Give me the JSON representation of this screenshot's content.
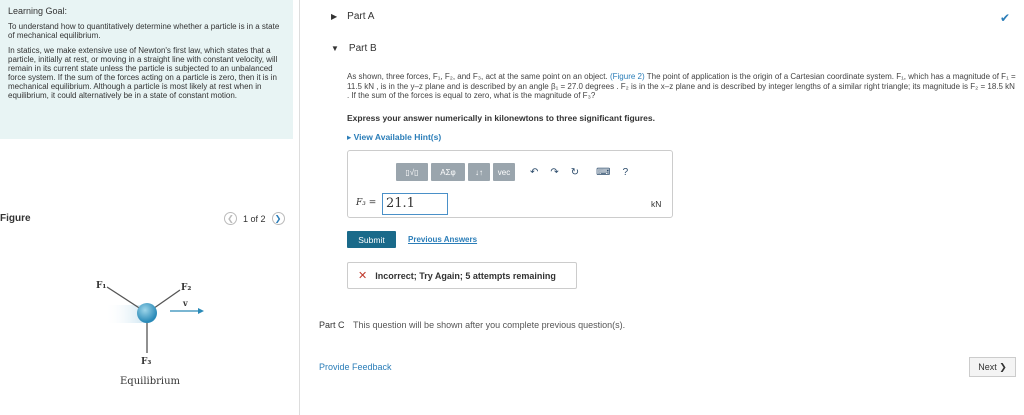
{
  "learning_goal": {
    "title": "Learning Goal:",
    "intro": "To understand how to quantitatively determine whether a particle is in a state of mechanical equilibrium.",
    "body": "In statics, we make extensive use of Newton's first law, which states that a particle, initially at rest, or moving in a straight line with constant velocity, will remain in its current state unless the particle is subjected to an unbalanced force system. If the sum of the forces acting on a particle is zero, then it is in mechanical equilibrium. Although a particle is most likely at rest when in equilibrium, it could alternatively be in a state of constant motion."
  },
  "figure": {
    "title": "Figure",
    "pager": "1 of 2",
    "caption": "Equilibrium",
    "labels": {
      "f1": "F₁",
      "f2": "F₂",
      "f3": "F₃",
      "v": "v"
    }
  },
  "partA": {
    "label": "Part A"
  },
  "partB": {
    "label": "Part B",
    "problem_pre": "As shown, three forces, F₁, F₂, and F₃, act at the same point on an object. ",
    "figure_link": "(Figure 2)",
    "problem_post": " The point of application is the origin of a Cartesian coordinate system. F₁, which has a magnitude of F₁ = 11.5 kN , is in the y–z plane and is described by an angle β₁ = 27.0 degrees . F₂ is in the x–z plane and is described by integer lengths of a similar right triangle; its magnitude is F₂ = 18.5 kN . If the sum of the forces is equal to zero, what is the magnitude of F₃?",
    "express": "Express your answer numerically in kilonewtons to three significant figures.",
    "hints": "▸ View Available Hint(s)",
    "toolbar": {
      "b1": "▯√▯",
      "b2": "ΑΣφ",
      "b3": "↓↑",
      "b4": "vec",
      "undo": "↶",
      "redo": "↷",
      "reset": "↻",
      "keyboard": "⌨",
      "help": "?"
    },
    "answer_label": "F₃ =",
    "answer_value": "21.1",
    "unit": "kN",
    "submit": "Submit",
    "previous": "Previous Answers",
    "feedback_x": "✕",
    "feedback_text": "Incorrect; Try Again; 5 attempts remaining"
  },
  "partC": {
    "label": "Part C",
    "message": "This question will be shown after you complete previous question(s)."
  },
  "footer": {
    "feedback": "Provide Feedback",
    "next": "Next ❯"
  },
  "icons": {
    "caret_right": "▶",
    "caret_down": "▼",
    "check": "✔",
    "prev": "❮",
    "next": "❯"
  },
  "colors": {
    "accent": "#2a7db8",
    "submit": "#1a6a8a",
    "goal_bg": "#e8f4f4",
    "error": "#c0392b"
  }
}
